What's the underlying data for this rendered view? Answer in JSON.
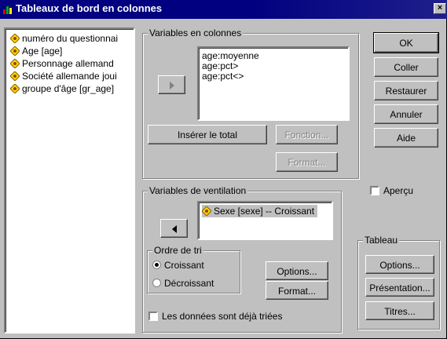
{
  "window": {
    "title": "Tableaux de bord en colonnes",
    "close": "×"
  },
  "source_list": [
    "numéro du questionnai",
    "Age [age]",
    "Personnage allemand",
    "Société allemande joui",
    "groupe d'âge [gr_age]"
  ],
  "columns_group": {
    "label": "Variables en colonnes",
    "items": [
      "age:moyenne",
      "age:pct>",
      "age:pct<>"
    ]
  },
  "buttons": {
    "insert_total": "Insérer le total",
    "function": "Fonction...",
    "format_top": "Format...",
    "ok": "OK",
    "paste": "Coller",
    "reset": "Restaurer",
    "cancel": "Annuler",
    "help": "Aide"
  },
  "breakdown_group": {
    "label": "Variables de ventilation",
    "items": [
      "Sexe [sexe] -- Croissant"
    ]
  },
  "sort_group": {
    "label": "Ordre de tri",
    "ascending": "Croissant",
    "descending": "Décroissant",
    "selected": "Croissant",
    "options_button": "Options...",
    "format_button": "Format..."
  },
  "already_sorted": "Les données sont déjà triées",
  "preview": "Aperçu",
  "table_group": {
    "label": "Tableau",
    "options": "Options...",
    "presentation": "Présentation...",
    "titles": "Titres..."
  },
  "colors": {
    "title_bg": "#000080",
    "face": "#c0c0c0",
    "selection": "#c0c0c0"
  }
}
